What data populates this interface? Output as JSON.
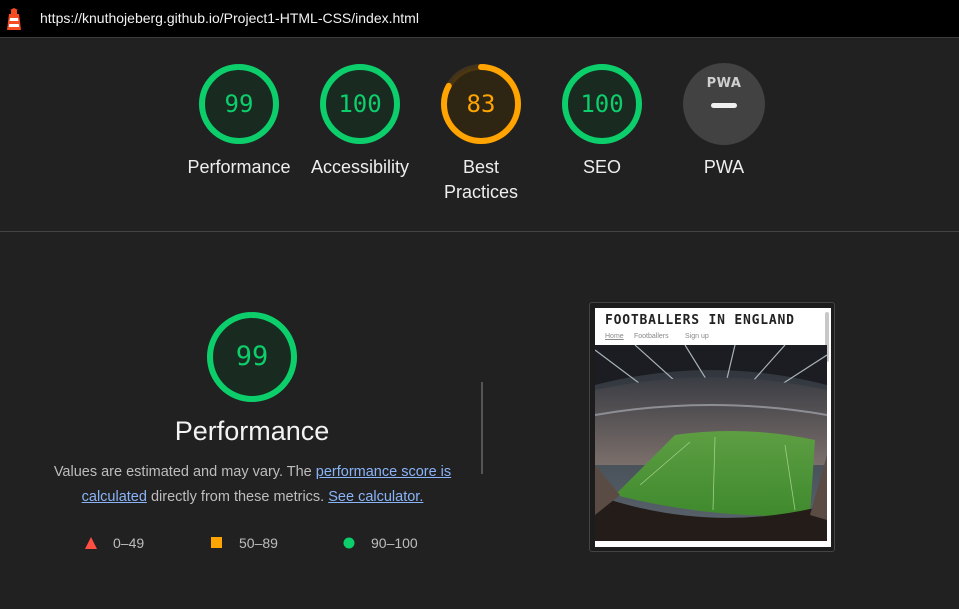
{
  "url": "https://knuthojeberg.github.io/Project1-HTML-CSS/index.html",
  "icons": {
    "lighthouse": "lighthouse-icon",
    "pwa": "pwa-badge-icon"
  },
  "colors": {
    "pass": "#0cce6b",
    "average": "#ffa400",
    "fail": "#ff4e42",
    "background": "#212121"
  },
  "gauges": [
    {
      "value": "99",
      "score": 99,
      "label": "Performance",
      "status": "pass"
    },
    {
      "value": "100",
      "score": 100,
      "label": "Accessibility",
      "status": "pass"
    },
    {
      "value": "83",
      "score": 83,
      "label": "Best Practices",
      "label_line1": "Best",
      "label_line2": "Practices",
      "status": "average"
    },
    {
      "value": "100",
      "score": 100,
      "label": "SEO",
      "status": "pass"
    },
    {
      "value": "",
      "score": null,
      "label": "PWA",
      "badge_text": "PWA",
      "status": "not-applicable"
    }
  ],
  "performance": {
    "value": "99",
    "score": 99,
    "title": "Performance",
    "desc_prefix": "Values are estimated and may vary. The ",
    "desc_link1": "performance score is calculated",
    "desc_middle": " directly from these metrics. ",
    "desc_link2": "See calculator."
  },
  "legend": [
    {
      "range": "0–49",
      "shape": "triangle",
      "status": "fail"
    },
    {
      "range": "50–89",
      "shape": "square",
      "status": "average"
    },
    {
      "range": "90–100",
      "shape": "circle",
      "status": "pass"
    }
  ],
  "screenshot": {
    "site_title": "FOOTBALLERS IN ENGLAND",
    "nav": [
      "Home",
      "Footballers",
      "Sign up"
    ]
  }
}
